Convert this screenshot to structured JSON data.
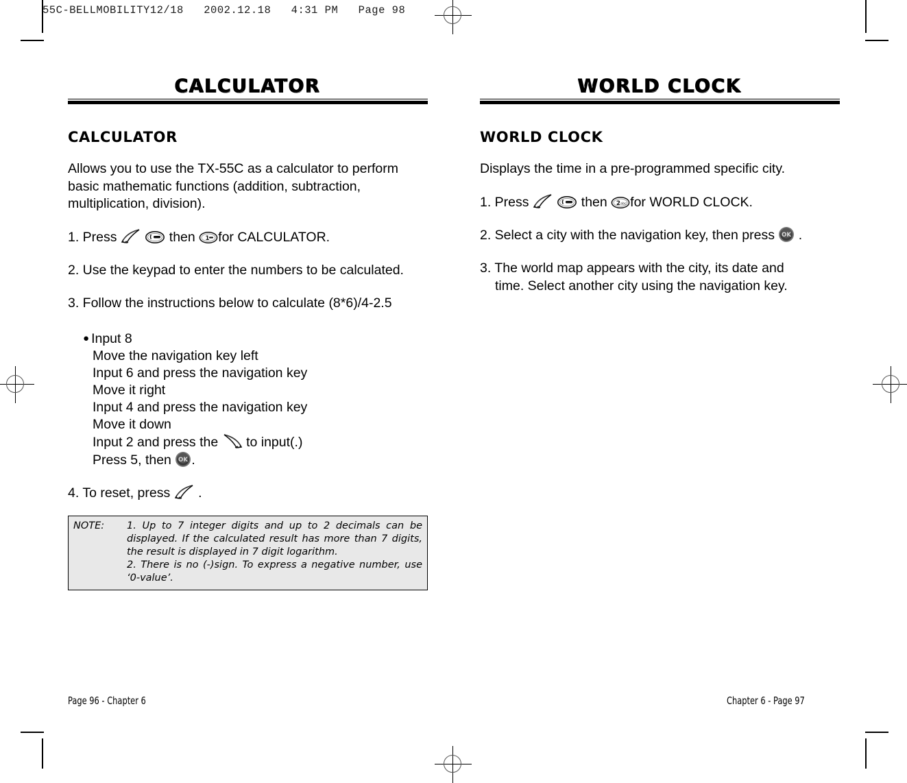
{
  "scan_header": "55C-BELLMOBILITY12/18   2002.12.18   4:31 PM   Page 98",
  "left_column": {
    "banner_title": "CALCULATOR",
    "section_title": "CALCULATOR",
    "intro": "Allows you to use the TX-55C as a calculator to perform basic mathematic functions (addition, subtraction, multiplication, division).",
    "step1_a": "1. Press",
    "step1_b": "then",
    "step1_c": "for CALCULATOR.",
    "step2": "2. Use the keypad to enter the numbers to be calculated.",
    "step3": "3. Follow the instructions below to calculate (8*6)/4-2.5",
    "bullets": [
      "Input 8",
      "Move the navigation key left",
      "Input 6 and press the navigation key",
      "Move it right",
      "Input 4 and press the navigation key",
      "Move it down"
    ],
    "bullet_input2_a": "Input 2 and press the",
    "bullet_input2_b": "to input(.)",
    "bullet_press5_a": "Press 5, then",
    "bullet_press5_b": ".",
    "step4_a": "4. To reset, press",
    "step4_b": ".",
    "note": {
      "label": "NOTE:",
      "line1": "1. Up to 7 integer digits and up to 2 decimals can be displayed. If the calculated result has more than 7 digits, the result is displayed in 7 digit logarithm.",
      "line2": "2. There is no (-)sign. To express a negative number, use ‘0-value’."
    },
    "footer": "Page 96 - Chapter 6"
  },
  "right_column": {
    "banner_title": "WORLD CLOCK",
    "section_title": "WORLD CLOCK",
    "intro": "Displays the time in a pre-programmed specific city.",
    "step1_a": "1. Press",
    "step1_b": "then",
    "step1_c": "for WORLD CLOCK.",
    "step2_a": "2. Select a city with the navigation key, then press",
    "step2_b": ".",
    "step3_line1": "3. The world map appears with the city, its date and",
    "step3_line2": "time. Select another city using the navigation key.",
    "footer": "Chapter 6 - Page 97"
  },
  "icons": {
    "clear_key": "clear-swoosh-key-icon",
    "menu_key": "menu-oval-key-icon",
    "key_one": "keypad-1-icon",
    "key_two": "keypad-2-icon",
    "ok_key": "ok-button-icon",
    "clear_key_mirrored": "clear-swoosh-key-mirrored-icon",
    "registration_mark": "registration-mark-icon",
    "crop_mark": "crop-mark-icon"
  },
  "colors": {
    "ink": "#000000",
    "paper": "#ffffff",
    "note_fill": "#e8e8e8",
    "ok_button": "#3a3a3a"
  }
}
